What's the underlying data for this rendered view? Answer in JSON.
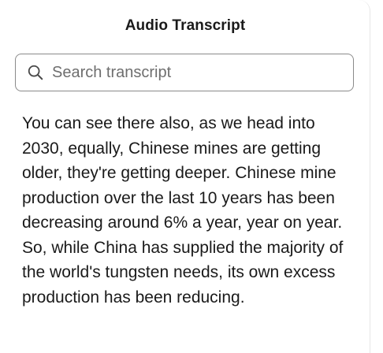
{
  "panel": {
    "title": "Audio Transcript"
  },
  "search": {
    "placeholder": "Search transcript",
    "value": "",
    "icon": "search-icon"
  },
  "transcript": {
    "text": "You can see there also, as we head into 2030, equally, Chinese mines are getting older, they're getting deeper. Chinese mine production over the last 10 years has been decreasing around 6% a year, year on year. So, while China has supplied the majority of the world's tungsten needs, its own excess production has been reducing."
  },
  "colors": {
    "text": "#1a1a1a",
    "border": "#8a8a8a",
    "placeholder": "#6e6e6e",
    "background": "#ffffff"
  }
}
